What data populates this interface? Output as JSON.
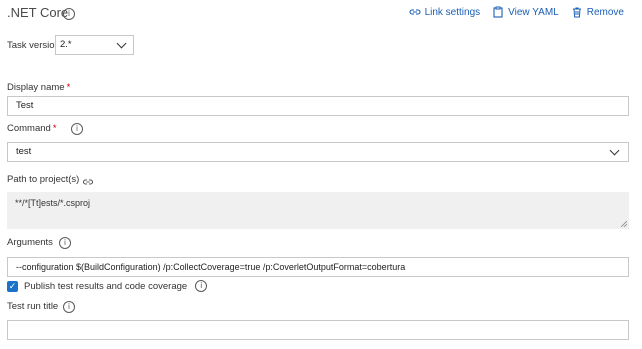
{
  "header": {
    "title": ".NET Core",
    "actions": {
      "link_settings": "Link settings",
      "view_yaml": "View YAML",
      "remove": "Remove"
    }
  },
  "task_version": {
    "label": "Task version",
    "value": "2.*"
  },
  "display_name": {
    "label": "Display name",
    "required_mark": "*",
    "value": "Test"
  },
  "command": {
    "label": "Command",
    "required_mark": "*",
    "value": "test"
  },
  "path_to_projects": {
    "label": "Path to project(s)",
    "value": "**/*[Tt]ests/*.csproj"
  },
  "arguments": {
    "label": "Arguments",
    "value": "--configuration $(BuildConfiguration) /p:CollectCoverage=true /p:CoverletOutputFormat=cobertura"
  },
  "publish_results": {
    "label": "Publish test results and code coverage",
    "checked": true
  },
  "test_run_title": {
    "label": "Test run title",
    "value": ""
  },
  "colors": {
    "accent": "#1a5fb4",
    "checkbox": "#1a73c8",
    "required": "#c00000"
  }
}
